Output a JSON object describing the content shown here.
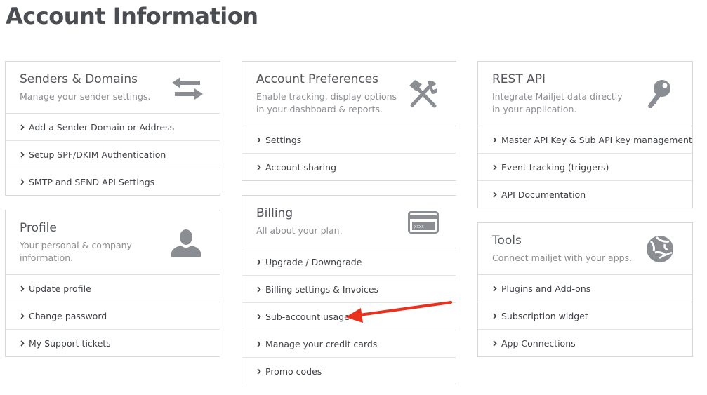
{
  "page": {
    "title": "Account Information"
  },
  "cards": {
    "senders": {
      "title": "Senders & Domains",
      "desc": "Manage your sender settings.",
      "icon": "arrows-exchange-icon",
      "items": [
        "Add a Sender Domain or Address",
        "Setup SPF/DKIM Authentication",
        "SMTP and SEND API Settings"
      ]
    },
    "profile": {
      "title": "Profile",
      "desc": "Your personal & company information.",
      "icon": "user-icon",
      "items": [
        "Update profile",
        "Change password",
        "My Support tickets"
      ]
    },
    "preferences": {
      "title": "Account Preferences",
      "desc": "Enable tracking, display options in your dashboard & reports.",
      "icon": "tools-icon",
      "items": [
        "Settings",
        "Account sharing"
      ]
    },
    "billing": {
      "title": "Billing",
      "desc": "All about your plan.",
      "icon": "credit-card-icon",
      "card_text": "XXXX",
      "items": [
        "Upgrade / Downgrade",
        "Billing settings & Invoices",
        "Sub-account usage",
        "Manage your credit cards",
        "Promo codes"
      ]
    },
    "restapi": {
      "title": "REST API",
      "desc": "Integrate Mailjet data directly in your application.",
      "icon": "key-icon",
      "items": [
        "Master API Key & Sub API key management",
        "Event tracking (triggers)",
        "API Documentation"
      ]
    },
    "tools": {
      "title": "Tools",
      "desc": "Connect mailjet with your apps.",
      "icon": "globe-icon",
      "items": [
        "Plugins and Add-ons",
        "Subscription widget",
        "App Connections"
      ]
    }
  },
  "colors": {
    "icon": "#8a8e93",
    "annotation_arrow": "#e8321f",
    "border": "#d8d8d8"
  }
}
